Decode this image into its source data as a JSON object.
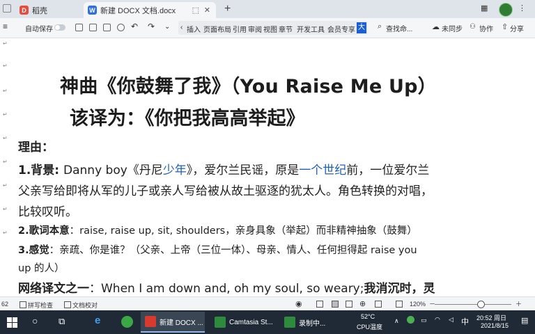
{
  "tabs": [
    {
      "label": "稻壳",
      "active": false
    },
    {
      "label": "新建 DOCX 文档.docx",
      "active": true
    }
  ],
  "toolbar": {
    "left_icon": "≡",
    "autosave_label": "自动保存",
    "menus": [
      "插入",
      "页面布局",
      "引用",
      "审阅",
      "视图",
      "章节",
      "开发工具",
      "会员专享",
      "大"
    ],
    "search_label": "查找命...",
    "sync_label": "未同步",
    "collab_label": "协作",
    "share_label": "分享"
  },
  "document": {
    "title": "神曲《你鼓舞了我》（You Raise Me Up）",
    "subtitle": "该译为：《你把我高高举起》",
    "reason_heading": "理由：",
    "p1_label": "1.背景: ",
    "p1_a": "Danny boy《丹尼",
    "p1_b": "少年",
    "p1_c": "》，爱尔兰民谣，原是",
    "p1_d": "一个世纪",
    "p1_e": "前，一位爱尔兰",
    "p1_line2": "父亲写给即将从军的儿子或亲人写给被从故土驱逐的犹太人。角色转换的对唱，",
    "p1_line3": "比较叹听。",
    "p2_label": "2.歌词本意",
    "p2_text": "：raise, raise up, sit, shoulders，亲身具象（举起）而非精神抽象（鼓舞）",
    "p3_label": "3.感觉",
    "p3_text": "：亲疏、你是谁？（父亲、上帝（三位一体）、母亲、情人、任何担得起 raise you",
    "p3_line2": "up  的人）",
    "p4_label": "网络译文之一",
    "p4_text": "：When I am down and, oh my soul, so weary;",
    "p4_bold": "我消沉时，灵"
  },
  "statusbar": {
    "page_num": "62",
    "spellcheck": "拼写检查",
    "compare": "文档校对",
    "zoom": "120%",
    "zoom_minus": "－",
    "zoom_plus": "＋",
    "zoom_level": 0.6
  },
  "taskbar": {
    "apps": [
      {
        "label": "新建 DOCX ...",
        "color": "#d83b2e"
      },
      {
        "label": "Camtasia St...",
        "color": "#2e8b3d"
      },
      {
        "label": "录制中...",
        "color": "#2e8b3d"
      }
    ],
    "weather_temp": "52°C",
    "weather_label": "CPU温度",
    "ime": "中",
    "time": "20:52 周日",
    "date": "2021/8/15"
  }
}
